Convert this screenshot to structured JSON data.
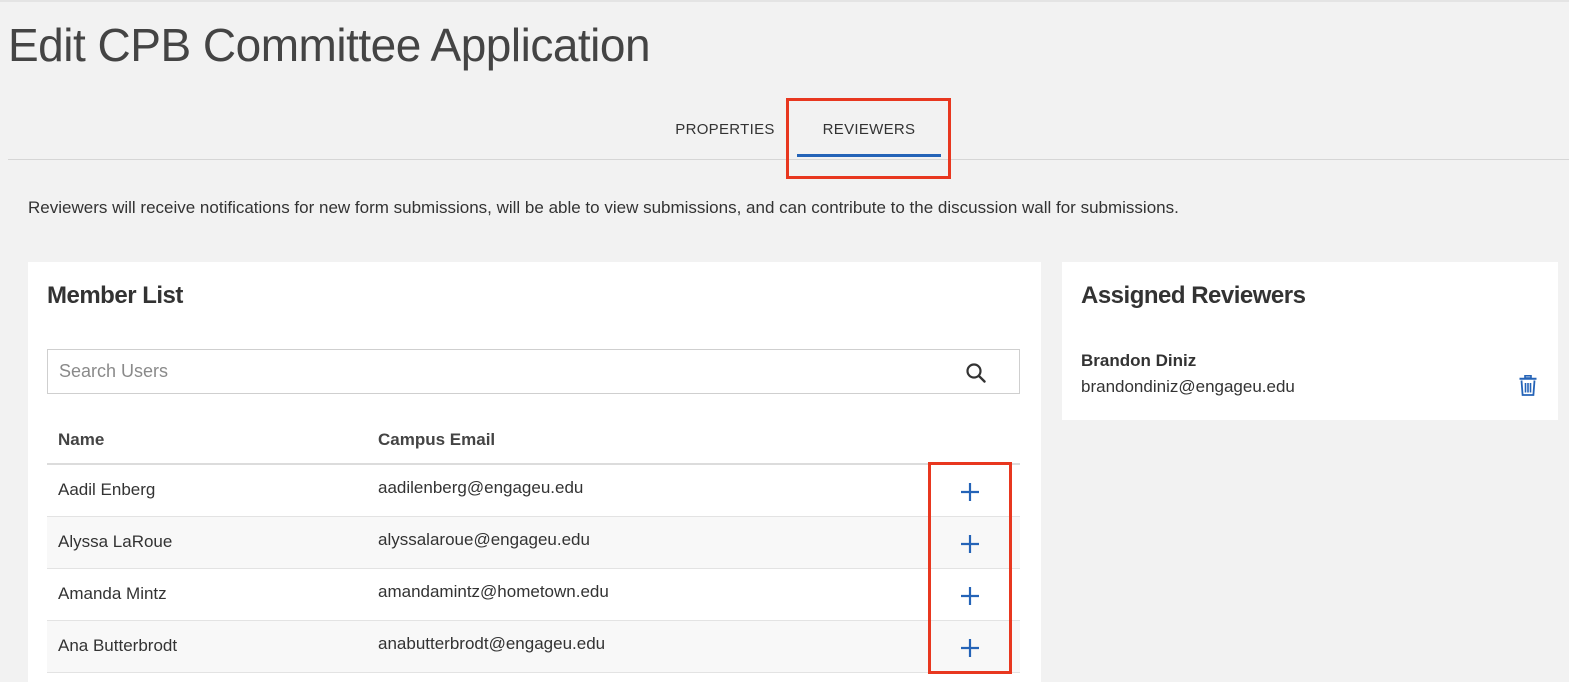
{
  "page": {
    "title": "Edit CPB Committee Application"
  },
  "tabs": [
    {
      "label": "PROPERTIES",
      "active": false
    },
    {
      "label": "REVIEWERS",
      "active": true
    }
  ],
  "description": "Reviewers will receive notifications for new form submissions, will be able to view submissions, and can contribute to the discussion wall for submissions.",
  "member_list": {
    "title": "Member List",
    "search": {
      "placeholder": "Search Users",
      "value": "",
      "icon": "search-icon"
    },
    "columns": [
      "Name",
      "Campus Email"
    ],
    "rows": [
      {
        "name": "Aadil Enberg",
        "email": "aadilenberg@engageu.edu"
      },
      {
        "name": "Alyssa LaRoue",
        "email": "alyssalaroue@engageu.edu"
      },
      {
        "name": "Amanda Mintz",
        "email": "amandamintz@hometown.edu"
      },
      {
        "name": "Ana Butterbrodt",
        "email": "anabutterbrodt@engageu.edu"
      }
    ],
    "add_icon": "plus-icon"
  },
  "assigned_reviewers": {
    "title": "Assigned Reviewers",
    "reviewers": [
      {
        "name": "Brandon Diniz",
        "email": "brandondiniz@engageu.edu"
      }
    ],
    "remove_icon": "trash-icon"
  },
  "colors": {
    "accent": "#2463b7",
    "highlight": "#e8371f",
    "background": "#f2f2f2"
  }
}
